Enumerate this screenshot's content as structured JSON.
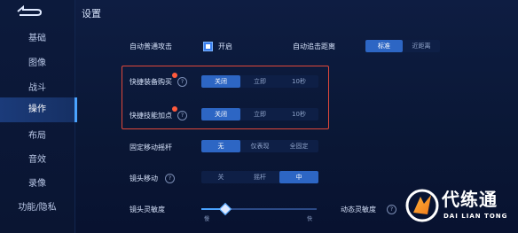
{
  "title": "设置",
  "sidebar": {
    "items": [
      {
        "label": "基础"
      },
      {
        "label": "图像"
      },
      {
        "label": "战斗"
      },
      {
        "label": "操作"
      },
      {
        "label": "布局"
      },
      {
        "label": "音效"
      },
      {
        "label": "录像"
      },
      {
        "label": "功能/隐私"
      }
    ],
    "active_index": 3
  },
  "rows": {
    "auto_attack": {
      "label": "自动普通攻击",
      "value_label": "开启",
      "checked": true
    },
    "auto_distance": {
      "label": "自动追击距离",
      "options": [
        "标准",
        "近距离"
      ],
      "selected": 0
    },
    "quick_buy": {
      "label": "快捷装备购买",
      "options": [
        "关闭",
        "立即",
        "10秒"
      ],
      "selected": 0
    },
    "quick_skill": {
      "label": "快捷技能加点",
      "options": [
        "关闭",
        "立即",
        "10秒"
      ],
      "selected": 0
    },
    "fixed_joystick": {
      "label": "固定移动摇杆",
      "options": [
        "无",
        "仅表现",
        "全固定"
      ],
      "selected": 0
    },
    "camera_move": {
      "label": "镜头移动",
      "options": [
        "关",
        "摇杆",
        "中"
      ],
      "selected": 2
    },
    "camera_sensitivity": {
      "label": "镜头灵敏度",
      "min_label": "慢",
      "max_label": "快",
      "value": 0.2
    },
    "dynamic_sensitivity": {
      "label": "动态灵敏度"
    }
  },
  "watermark": {
    "cn": "代练通",
    "en": "DAI LIAN TONG"
  },
  "colors": {
    "accent": "#2d66c4",
    "highlight_box": "#e0483a",
    "background": "#0a1633"
  }
}
